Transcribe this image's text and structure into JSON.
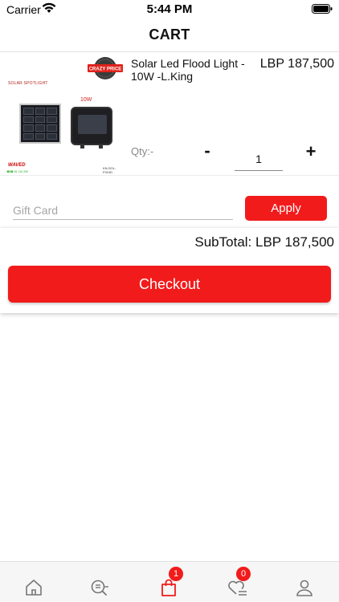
{
  "status_bar": {
    "carrier": "Carrier",
    "time": "5:44 PM"
  },
  "header": {
    "title": "CART"
  },
  "cart": {
    "items": [
      {
        "name": "Solar Led Flood Light - 10W -L.King",
        "price": "LBP 187,500",
        "qty_label": "Qty:-",
        "quantity": "1",
        "minus_label": "-",
        "plus_label": "+",
        "image_text": {
          "top_label": "SOLAR SPOTLIGHT",
          "wattage": "10W",
          "code": "KN-SOL-F010D",
          "brand": "WAVED",
          "badge": "CRAZY PRICE"
        }
      }
    ]
  },
  "gift_card": {
    "placeholder": "Gift Card",
    "value": "",
    "apply_label": "Apply"
  },
  "summary": {
    "subtotal": "SubTotal: LBP 187,500",
    "checkout_label": "Checkout"
  },
  "tab_bar": {
    "tabs": [
      {
        "icon": "home-icon",
        "badge": ""
      },
      {
        "icon": "search-list-icon",
        "badge": ""
      },
      {
        "icon": "shopping-bag-icon",
        "badge": "1",
        "active": true
      },
      {
        "icon": "heart-list-icon",
        "badge": "0"
      },
      {
        "icon": "user-icon",
        "badge": ""
      }
    ]
  },
  "colors": {
    "accent": "#f21b1b",
    "tab_inactive": "#777777"
  }
}
